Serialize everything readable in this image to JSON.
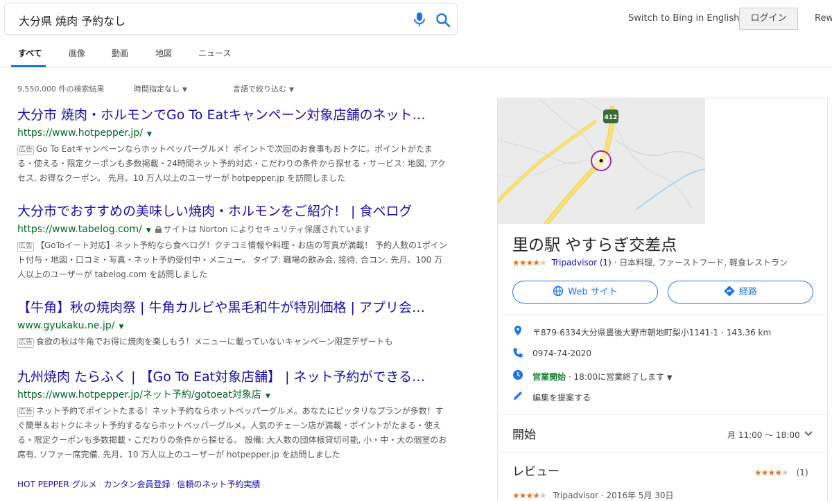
{
  "search": {
    "query": "大分県 焼肉 予約なし"
  },
  "header": {
    "switch_link": "Switch to Bing in English",
    "login": "ログイン",
    "rewards": "Rew"
  },
  "tabs": [
    "すべて",
    "画像",
    "動画",
    "地図",
    "ニュース"
  ],
  "filters": {
    "count": "9,550,000 件の検索結果",
    "time": "時間指定なし",
    "language": "言語で絞り込む"
  },
  "ad_badge": "広告",
  "results": [
    {
      "title": "大分市 焼肉・ホルモンでGo To Eatキャンペーン対象店舗のネット…",
      "url": "https://www.hotpepper.jp/",
      "desc": "Go To Eatキャンペーンならホットペッパーグルメ！ポイントで次回のお食事もおトクに。ポイントがたまる・使える・限定クーポンも多数掲載・24時間ネット予約対応・こだわりの条件から探せる・サービス: 地図, アクセス, お得なクーポン。 先月、10 万人以上のユーザーが hotpepper.jp を訪問しました"
    },
    {
      "title": "大分市でおすすめの美味しい焼肉・ホルモンをご紹介！ | 食べログ",
      "url": "https://www.tabelog.com/",
      "note": "サイトは Norton によりセキュリティ保護されています",
      "desc": "【GoToイート対応】ネット予約なら食べログ！クチコミ情報や料理・お店の写真が満載！ 予約人数の1ポイント付与・地図・口コミ・写真・ネット予約受付中・メニュー。 タイプ: 職場の飲み会, 接待, 合コン. 先月、100 万人以上のユーザーが tabelog.com を訪問しました"
    },
    {
      "title": "【牛角】秋の焼肉祭 | 牛角カルビや黒毛和牛が特別価格 | アプリ会…",
      "url": "www.gyukaku.ne.jp/",
      "desc": "食欲の秋は牛角でお得に焼肉を楽しもう！メニューに載っていないキャンペーン限定デザートも"
    },
    {
      "title": "九州焼肉 たらふく | 【Go To Eat対象店舗】 | ネット予約ができる…",
      "url": "https://www.hotpepper.jp/ネット予約/gotoeat対象店",
      "desc": "ネット予約でポイントたまる！ネット予約ならホットペッパーグルメ。あなたにピッタリなプランが多数！すぐ簡単＆おトクにネット予約するならホットペッパーグルメ。人気のチェーン店が満載・ポイントがたまる・使える・限定クーポンも多数掲載・こだわりの条件から探せる。 設備: 大人数の団体様貸切可能, 小・中・大の個室のお席有, ソファー席完備. 先月、10 万人以上のユーザーが hotpepper.jp を訪問しました"
    }
  ],
  "sitelinks": [
    "HOT PEPPER グルメ",
    "カンタン会員登録",
    "信頼のネット予約実績"
  ],
  "panel": {
    "map_label": "412",
    "title": "里の駅 やすらぎ交差点",
    "rating_source": "Tripadvisor (1)",
    "categories": "· 日本料理, ファーストフード, 軽食レストラン",
    "website_btn": "Web サイト",
    "directions_btn": "経路",
    "address": "〒879-6334大分県豊後大野市朝地町梨小1141-1 · 143.36 km",
    "phone": "0974-74-2020",
    "open_label": "営業開始",
    "open_detail": "· 18:00に営業終了します",
    "suggest_edit": "編集を提案する",
    "hours_title": "開始",
    "hours": "月 11:00 ～ 18:00",
    "reviews_title": "レビュー",
    "reviews_count": "(1)",
    "review_source": "Tripadvisor · 2016年 5月 30日"
  },
  "colors": {
    "link": "#1a0dab",
    "url": "#006621",
    "accent": "#1a73e8",
    "star": "#e7711b",
    "open": "#188038"
  }
}
